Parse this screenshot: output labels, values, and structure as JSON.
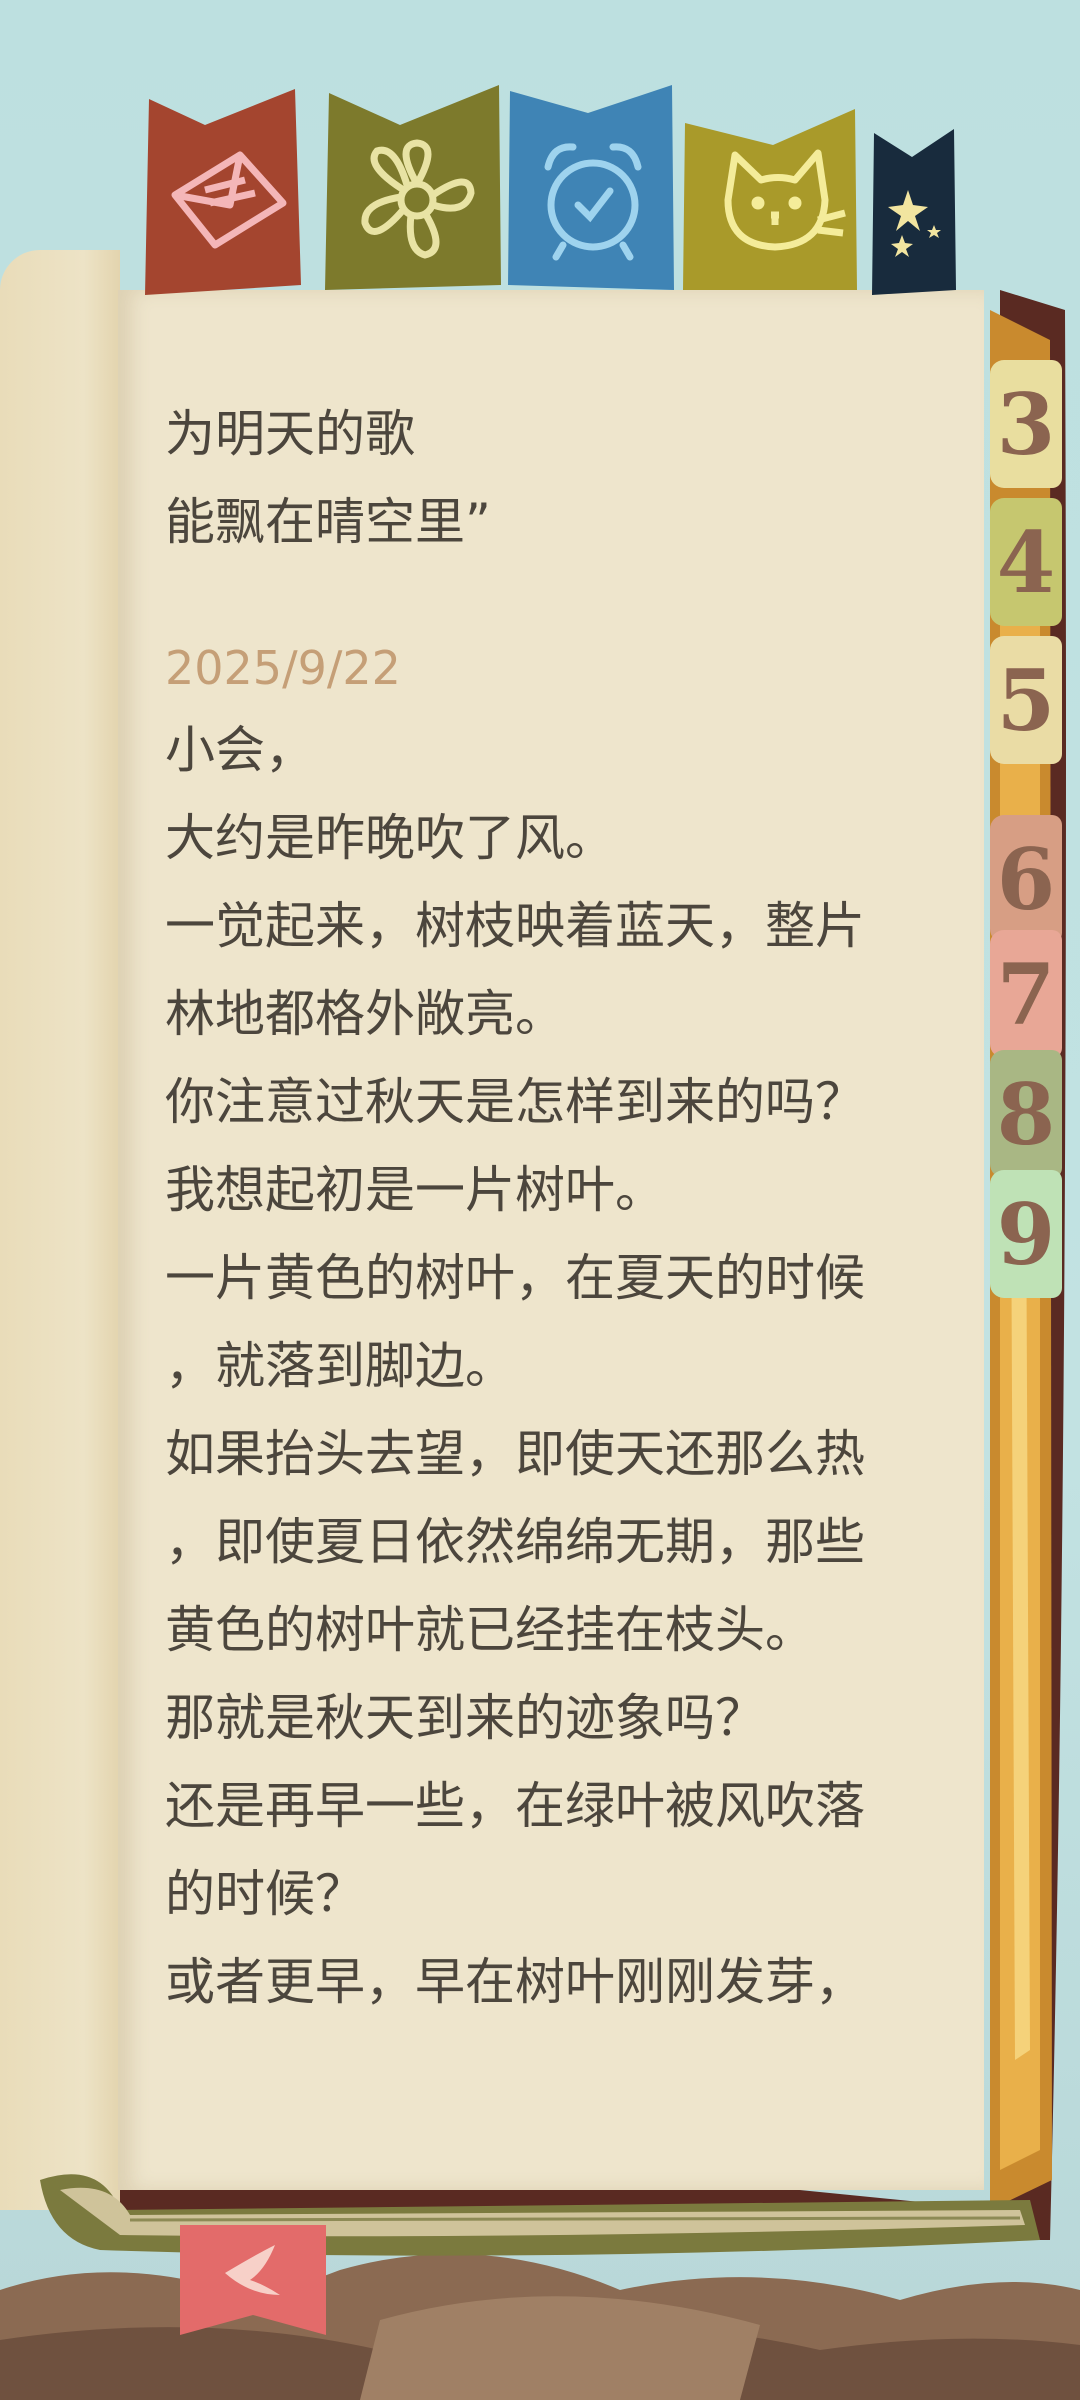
{
  "colors": {
    "page": "#eee5cc",
    "text": "#4c463d",
    "date": "#c59f77",
    "flag_envelope": "#a4452f",
    "flag_flower": "#7d7a2c",
    "flag_clock": "#3f84b5",
    "flag_cat": "#a99a2a",
    "flag_star": "#182b3d"
  },
  "flags": [
    {
      "icon": "envelope-icon"
    },
    {
      "icon": "flower-icon"
    },
    {
      "icon": "alarm-clock-icon"
    },
    {
      "icon": "cat-icon"
    },
    {
      "icon": "stars-icon"
    }
  ],
  "tabs": [
    "3",
    "4",
    "5",
    "6",
    "7",
    "8",
    "9"
  ],
  "poem_tail": [
    "为明天的歌",
    "能飘在晴空里”"
  ],
  "entry": {
    "date": "2025/9/22",
    "lines": [
      "小会，",
      "大约是昨晚吹了风。",
      "一觉起来，树枝映着蓝天，整片",
      "林地都格外敞亮。",
      "你注意过秋天是怎样到来的吗？",
      "我想起初是一片树叶。",
      "一片黄色的树叶，在夏天的时候",
      "，就落到脚边。",
      "如果抬头去望，即使天还那么热",
      "，即使夏日依然绵绵无期，那些",
      "黄色的树叶就已经挂在枝头。",
      "那就是秋天到来的迹象吗？",
      "还是再早一些，在绿叶被风吹落",
      "的时候？",
      "或者更早，早在树叶刚刚发芽，"
    ]
  },
  "bookmark_icon": "bird-icon"
}
